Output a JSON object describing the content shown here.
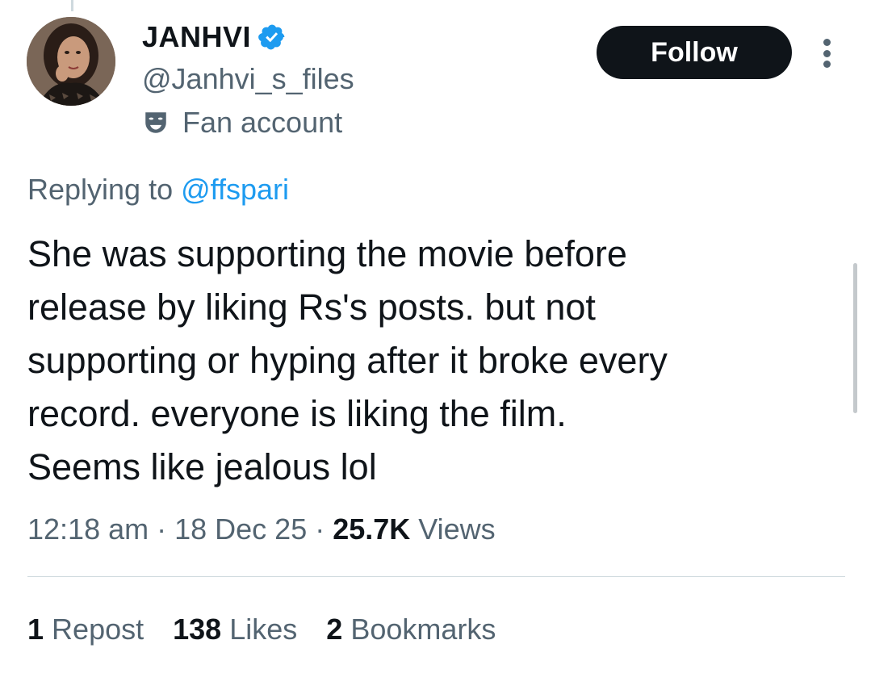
{
  "author": {
    "display_name": "JANHVI",
    "handle": "@Janhvi_s_files",
    "label": "Fan account",
    "verified": true
  },
  "actions": {
    "follow_label": "Follow",
    "more_icon": "more-vertical-icon"
  },
  "reply": {
    "prefix": "Replying to ",
    "to": "@ffspari"
  },
  "tweet": {
    "lines": [
      "She was supporting the movie before",
      "release by liking Rs's posts. but not",
      "supporting or hyping after it broke every",
      "record. everyone is liking the film.",
      "Seems like jealous lol"
    ]
  },
  "meta": {
    "time": "12:18 am",
    "sep1": " · ",
    "date": "18 Dec 25",
    "sep2": " · ",
    "views_count": "25.7K",
    "views_label": " Views"
  },
  "stats": {
    "reposts": {
      "count": "1",
      "label": "Repost"
    },
    "likes": {
      "count": "138",
      "label": "Likes"
    },
    "bookmarks": {
      "count": "2",
      "label": "Bookmarks"
    }
  },
  "colors": {
    "text": "#0f1419",
    "secondary": "#536471",
    "link": "#1d9bf0",
    "verified": "#1d9bf0",
    "button_bg": "#0f1419",
    "divider": "#cfd9de"
  }
}
